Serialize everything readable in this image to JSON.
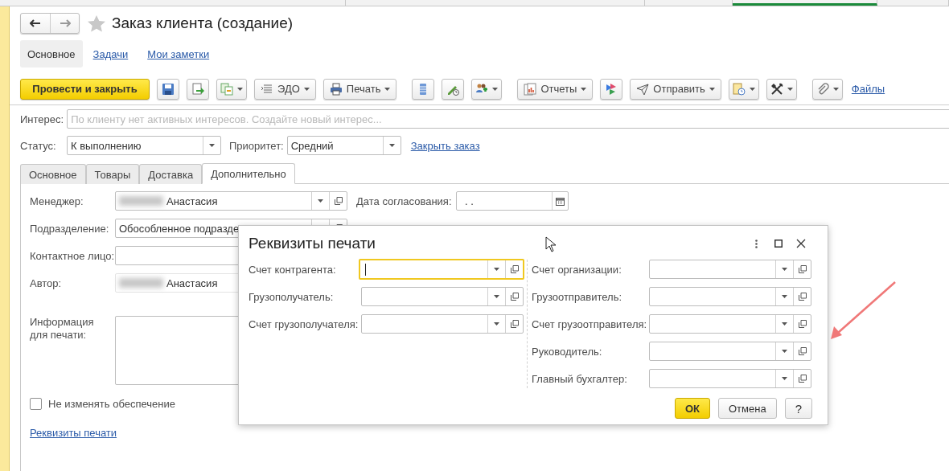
{
  "favorite": false,
  "title": "Заказ клиента (создание)",
  "sections": [
    {
      "label": "Основное",
      "selected": true
    },
    {
      "label": "Задачи",
      "selected": false
    },
    {
      "label": "Мои заметки",
      "selected": false
    }
  ],
  "toolbar": [
    {
      "kind": "primary",
      "label": "Провести и закрыть"
    },
    {
      "kind": "icon"
    },
    {
      "kind": "icon"
    },
    {
      "kind": "icon-menu"
    },
    {
      "kind": "menu",
      "label": "ЭДО"
    },
    {
      "kind": "menu",
      "label": "Печать"
    },
    {
      "kind": "icon"
    },
    {
      "kind": "icon"
    },
    {
      "kind": "icon-menu"
    },
    {
      "kind": "menu",
      "label": "Отчеты"
    },
    {
      "kind": "icon"
    },
    {
      "kind": "menu",
      "label": "Отправить"
    },
    {
      "kind": "icon-menu"
    },
    {
      "kind": "icon-menu"
    },
    {
      "kind": "icon-menu"
    },
    {
      "kind": "link",
      "label": "Файлы"
    }
  ],
  "interest": {
    "label": "Интерес:",
    "placeholder": "По клиенту нет активных интересов. Создайте новый интерес..."
  },
  "status": {
    "label": "Статус:",
    "value": "К выполнению"
  },
  "priority": {
    "label": "Приоритет:",
    "value": "Средний"
  },
  "close_order": "Закрыть заказ",
  "tabs": [
    {
      "label": "Основное",
      "selected": false
    },
    {
      "label": "Товары",
      "selected": false
    },
    {
      "label": "Доставка",
      "selected": false
    },
    {
      "label": "Дополнительно",
      "selected": true
    }
  ],
  "form": [
    {
      "label": "Менеджер:",
      "kind": "select",
      "value": "Анастасия",
      "redacted": true
    },
    {
      "label": "Подразделение:",
      "kind": "select",
      "value": "Обособленное подразде",
      "redacted": false
    },
    {
      "label": "Контактное лицо:",
      "kind": "text"
    },
    {
      "label": "Автор:",
      "kind": "plain",
      "value": "Анастасия",
      "redacted": true
    },
    {
      "label": "Информация для печати:",
      "kind": "textarea"
    }
  ],
  "approval_date": {
    "label": "Дата согласования:",
    "value": ".  ."
  },
  "keep_reserve": {
    "label": "Не изменять обеспечение",
    "checked": false
  },
  "print_details_link": "Реквизиты печати",
  "dialog": {
    "title": "Реквизиты печати",
    "left": [
      {
        "label": "Счет контрагента:",
        "focused": true
      },
      {
        "label": "Грузополучатель:",
        "focused": false
      },
      {
        "label": "Счет грузополучателя:",
        "focused": false
      }
    ],
    "right": [
      {
        "label": "Счет организации:",
        "focused": false
      },
      {
        "label": "Грузоотправитель:",
        "focused": false
      },
      {
        "label": "Счет грузоотправителя:",
        "focused": false
      },
      {
        "label": "Руководитель:",
        "focused": false
      },
      {
        "label": "Главный бухгалтер:",
        "focused": false
      }
    ],
    "buttons": [
      {
        "kind": "default",
        "label": "ОК"
      },
      {
        "kind": "normal",
        "label": "Отмена"
      },
      {
        "kind": "normal",
        "label": "?"
      }
    ]
  }
}
